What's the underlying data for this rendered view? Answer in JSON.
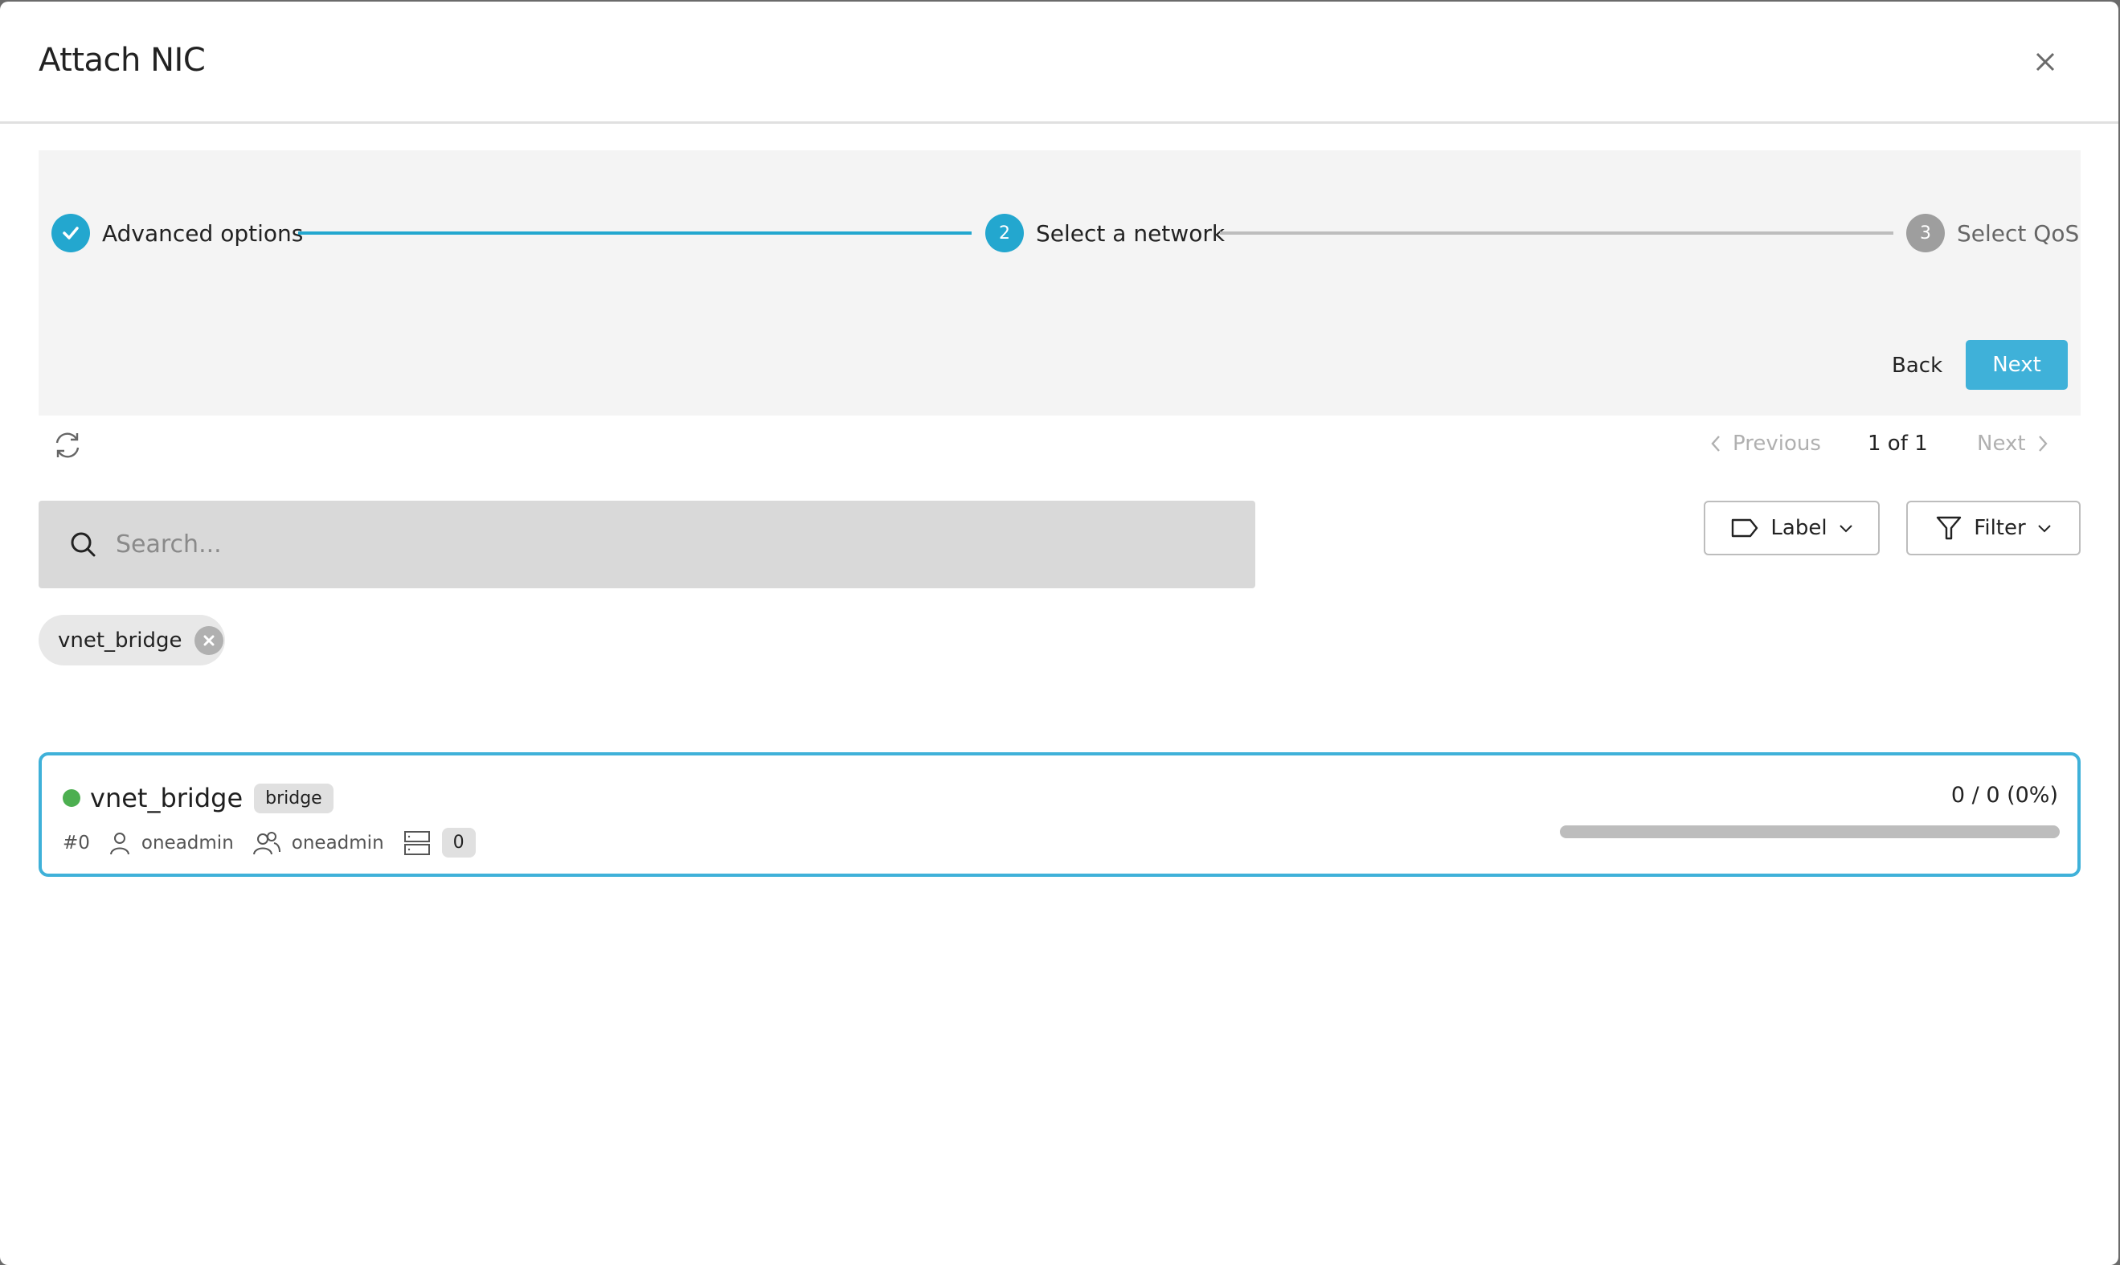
{
  "dialog": {
    "title": "Attach NIC",
    "close_icon": "close-icon"
  },
  "stepper": {
    "steps": [
      {
        "number": "1",
        "label": "Advanced options",
        "state": "completed",
        "icon": "check-icon"
      },
      {
        "number": "2",
        "label": "Select a network",
        "state": "active"
      },
      {
        "number": "3",
        "label": "Select QoS",
        "state": "pending"
      }
    ],
    "back_label": "Back",
    "next_label": "Next"
  },
  "toolbar": {
    "refresh_icon": "refresh-icon",
    "pagination": {
      "previous_label": "Previous",
      "info": "1 of 1",
      "next_label": "Next"
    },
    "search": {
      "placeholder": "Search...",
      "value": ""
    },
    "label_button": "Label",
    "filter_button": "Filter"
  },
  "active_filters": [
    {
      "label": "vnet_bridge"
    }
  ],
  "networks": [
    {
      "name": "vnet_bridge",
      "status": "ready",
      "type": "bridge",
      "id": "#0",
      "owner": "oneadmin",
      "group": "oneadmin",
      "clusters": "0",
      "usage_text": "0 / 0 (0%)",
      "usage_percent": 0,
      "selected": true
    }
  ],
  "colors": {
    "accent": "#3fb1d9",
    "step_active": "#23a7cf",
    "step_pending": "#9e9e9e",
    "status_ready": "#4caf50",
    "panel_bg": "#f4f4f4",
    "search_bg": "#d9d9d9"
  }
}
